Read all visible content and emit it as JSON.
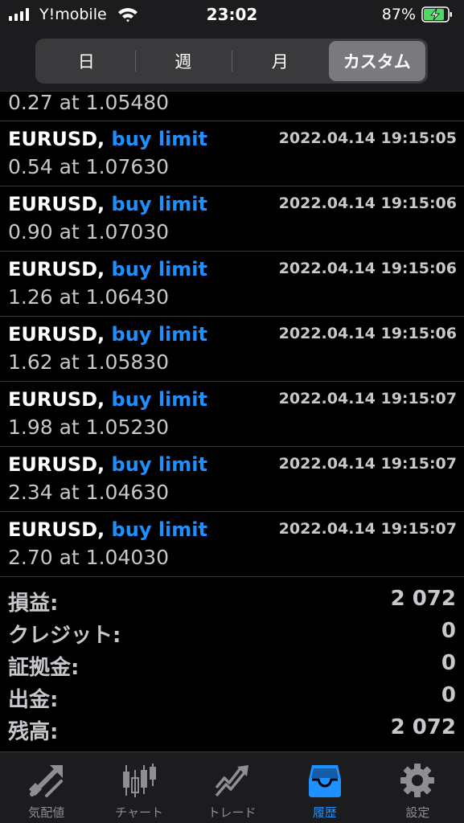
{
  "status": {
    "carrier": "Y!mobile",
    "time": "23:02",
    "battery": "87%"
  },
  "tabs": [
    {
      "label": "日"
    },
    {
      "label": "週"
    },
    {
      "label": "月"
    },
    {
      "label": "カスタム",
      "selected": true
    }
  ],
  "partial_order": {
    "detail": "0.27 at 1.05480"
  },
  "orders": [
    {
      "symbol": "EURUSD,",
      "type": "buy limit",
      "time": "2022.04.14 19:15:05",
      "detail": "0.54 at 1.07630"
    },
    {
      "symbol": "EURUSD,",
      "type": "buy limit",
      "time": "2022.04.14 19:15:06",
      "detail": "0.90 at 1.07030"
    },
    {
      "symbol": "EURUSD,",
      "type": "buy limit",
      "time": "2022.04.14 19:15:06",
      "detail": "1.26 at 1.06430"
    },
    {
      "symbol": "EURUSD,",
      "type": "buy limit",
      "time": "2022.04.14 19:15:06",
      "detail": "1.62 at 1.05830"
    },
    {
      "symbol": "EURUSD,",
      "type": "buy limit",
      "time": "2022.04.14 19:15:07",
      "detail": "1.98 at 1.05230"
    },
    {
      "symbol": "EURUSD,",
      "type": "buy limit",
      "time": "2022.04.14 19:15:07",
      "detail": "2.34 at 1.04630"
    },
    {
      "symbol": "EURUSD,",
      "type": "buy limit",
      "time": "2022.04.14 19:15:07",
      "detail": "2.70 at 1.04030"
    }
  ],
  "summary": [
    {
      "label": "損益:",
      "value": "2 072"
    },
    {
      "label": "クレジット:",
      "value": "0"
    },
    {
      "label": "証拠金:",
      "value": "0"
    },
    {
      "label": "出金:",
      "value": "0"
    },
    {
      "label": "残高:",
      "value": "2 072"
    }
  ],
  "nav": [
    {
      "label": "気配値",
      "icon": "quotes-icon"
    },
    {
      "label": "チャート",
      "icon": "chart-icon"
    },
    {
      "label": "トレード",
      "icon": "trade-icon"
    },
    {
      "label": "履歴",
      "icon": "history-icon",
      "active": true
    },
    {
      "label": "設定",
      "icon": "settings-icon"
    }
  ],
  "colors": {
    "accent": "#1e90ff",
    "background": "#000000",
    "battery": "#4cd964"
  }
}
